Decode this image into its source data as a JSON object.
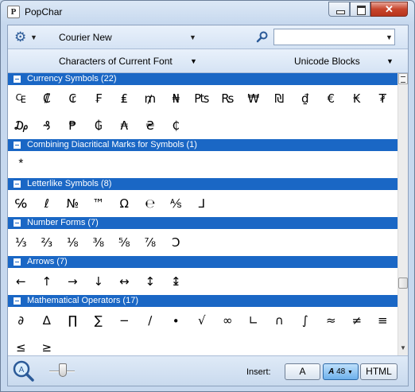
{
  "window": {
    "title": "PopChar",
    "app_icon_letter": "P"
  },
  "toolbar": {
    "font": "Courier New",
    "search_value": "",
    "view_mode": "Characters of Current Font",
    "blocks": "Unicode Blocks"
  },
  "sections": [
    {
      "title": "Currency Symbols (22)",
      "chars": [
        "₠",
        "₡",
        "₢",
        "₣",
        "₤",
        "₥",
        "₦",
        "₧",
        "₨",
        "₩",
        "₪",
        "₫",
        "€",
        "₭",
        "₮",
        "₯",
        "₰",
        "₱",
        "₲",
        "₳",
        "₴",
        "₵"
      ]
    },
    {
      "title": "Combining Diacritical Marks for Symbols (1)",
      "chars": [
        "⃰"
      ]
    },
    {
      "title": "Letterlike Symbols (8)",
      "chars": [
        "℅",
        "ℓ",
        "№",
        "™",
        "Ω",
        "℮",
        "⅍",
        "⅃"
      ]
    },
    {
      "title": "Number Forms (7)",
      "chars": [
        "⅓",
        "⅔",
        "⅛",
        "⅜",
        "⅝",
        "⅞",
        "Ↄ"
      ]
    },
    {
      "title": "Arrows (7)",
      "chars": [
        "←",
        "↑",
        "→",
        "↓",
        "↔",
        "↕",
        "↨"
      ]
    },
    {
      "title": "Mathematical Operators (17)",
      "chars": [
        "∂",
        "∆",
        "∏",
        "∑",
        "−",
        "∕",
        "∙",
        "√",
        "∞",
        "∟",
        "∩",
        "∫",
        "≈",
        "≠",
        "≡",
        "≤",
        "≥"
      ]
    }
  ],
  "status": {
    "insert_label": "Insert:",
    "insert_char": "A",
    "insert_glyph": "48",
    "insert_html": "HTML"
  },
  "colors": {
    "section_header": "#1a67c5",
    "close_button": "#c7452c"
  }
}
